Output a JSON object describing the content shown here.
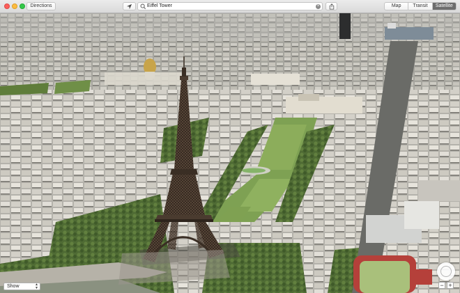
{
  "toolbar": {
    "directions_label": "Directions",
    "location_icon": "location-arrow-icon",
    "search": {
      "value": "Eiffel Tower",
      "search_icon": "magnifier-icon",
      "clear_icon": "clear-x-icon"
    },
    "share_icon": "share-icon",
    "view_modes": [
      {
        "label": "Map",
        "selected": false
      },
      {
        "label": "Transit",
        "selected": false
      },
      {
        "label": "Satellite",
        "selected": true
      }
    ]
  },
  "window_controls": {
    "close_color": "#fc605c",
    "minimize_color": "#fdbc40",
    "zoom_color": "#34c84a"
  },
  "map_controls": {
    "show_label": "Show",
    "compass_icon": "compass-icon",
    "zoom_out_label": "−",
    "zoom_in_label": "+"
  },
  "colors": {
    "accent": "#6d6d6d",
    "park_green": "#7ea153",
    "track_red": "#b5403a"
  }
}
